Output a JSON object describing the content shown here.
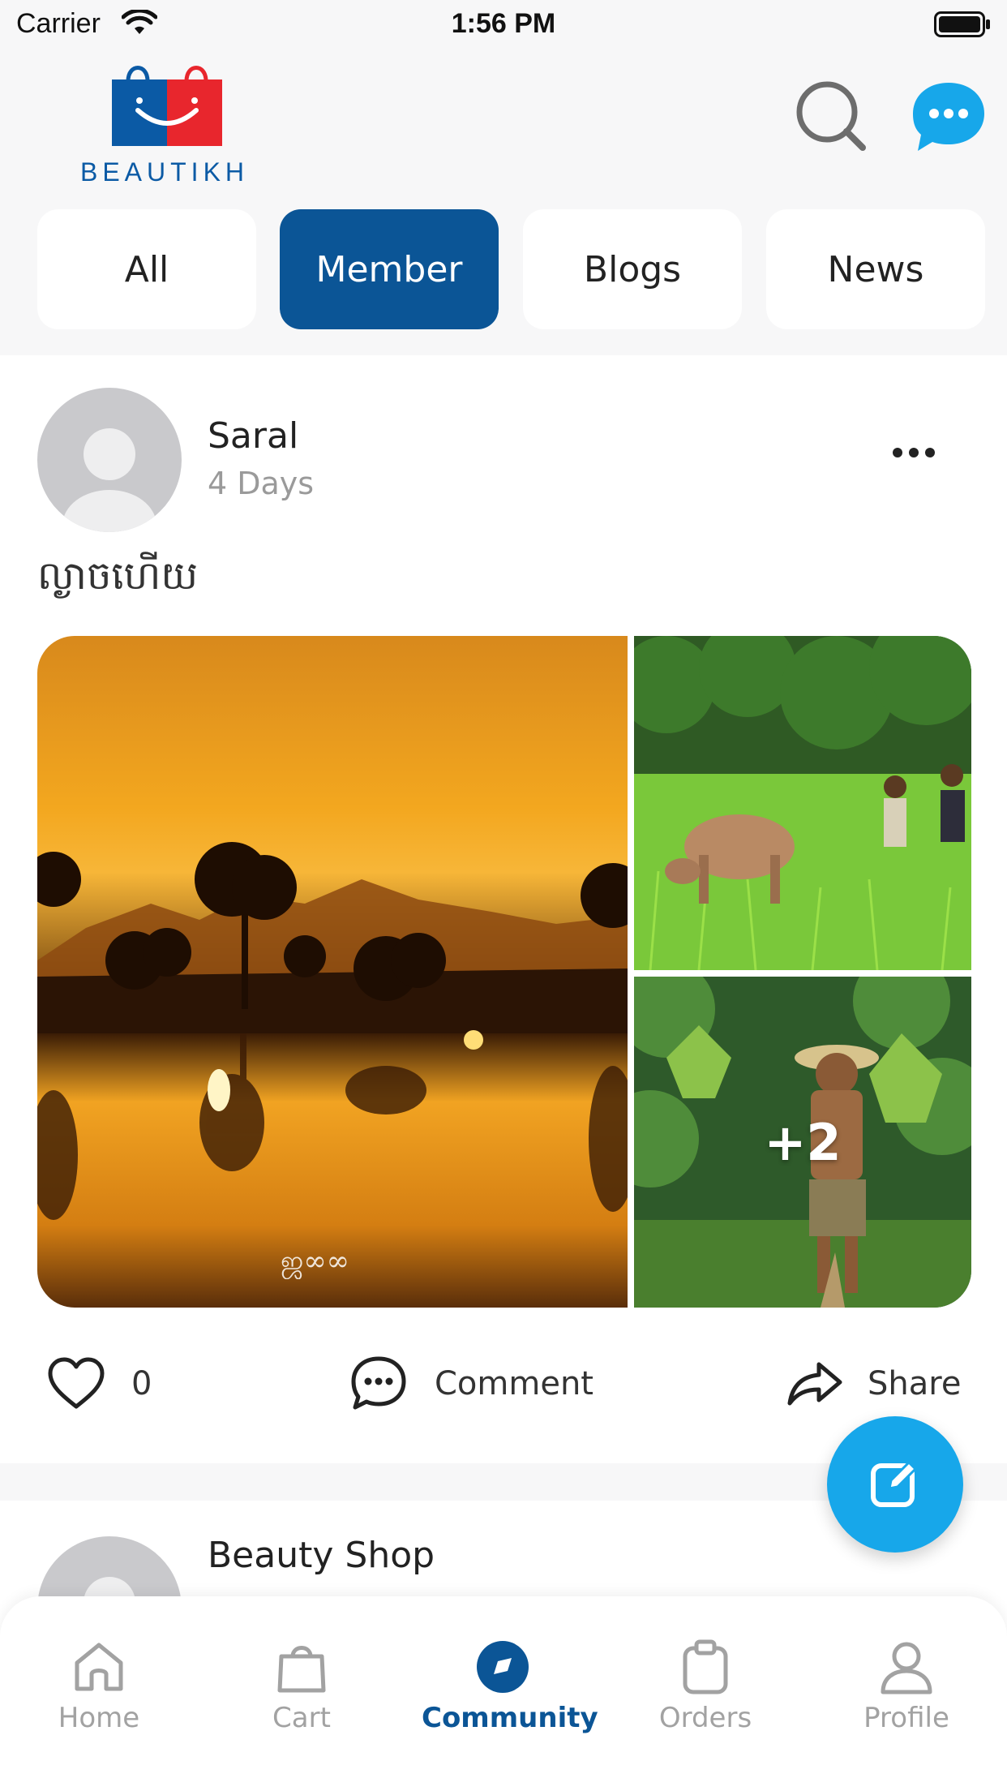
{
  "status_bar": {
    "carrier": "Carrier",
    "time": "1:56 PM"
  },
  "header": {
    "brand": "BEAUTIKH",
    "search_icon": "search-icon",
    "chat_icon": "chat-bubble-icon"
  },
  "tabs": [
    {
      "label": "All",
      "active": false
    },
    {
      "label": "Member",
      "active": true
    },
    {
      "label": "Blogs",
      "active": false
    },
    {
      "label": "News",
      "active": false
    }
  ],
  "posts": [
    {
      "author": "Saral",
      "time_ago": "4 Days",
      "caption": "ល្ងាចហើយ",
      "gallery": {
        "more_count": "+2",
        "photos": [
          "sunset-lake-photo",
          "cow-rice-field-photo",
          "farmer-seedlings-photo"
        ]
      },
      "likes": "0",
      "comment_label": "Comment",
      "share_label": "Share"
    },
    {
      "author": "Beauty Shop"
    }
  ],
  "fab": {
    "icon": "edit-icon"
  },
  "bottom_nav": [
    {
      "label": "Home",
      "icon": "home-icon",
      "active": false
    },
    {
      "label": "Cart",
      "icon": "bag-icon",
      "active": false
    },
    {
      "label": "Community",
      "icon": "community-icon",
      "active": true
    },
    {
      "label": "Orders",
      "icon": "clipboard-icon",
      "active": false
    },
    {
      "label": "Profile",
      "icon": "user-icon",
      "active": false
    }
  ],
  "colors": {
    "primary": "#0b5596",
    "accent": "#17a7ea",
    "logo_red": "#e8262d",
    "background": "#f7f7f8"
  }
}
